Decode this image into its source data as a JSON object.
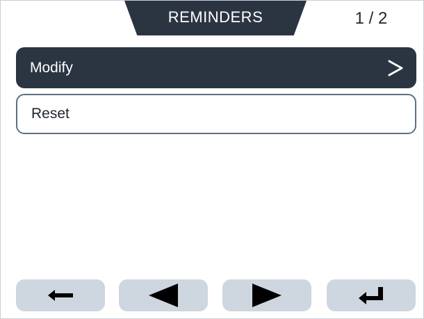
{
  "header": {
    "title": "REMINDERS",
    "page_indicator": "1 / 2"
  },
  "menu": {
    "items": [
      {
        "label": "Modify",
        "selected": true,
        "icon": "chevron-right-icon"
      },
      {
        "label": "Reset",
        "selected": false
      }
    ]
  },
  "buttons": [
    {
      "name": "back-button",
      "icon": "arrow-left-icon"
    },
    {
      "name": "previous-button",
      "icon": "triangle-left-icon"
    },
    {
      "name": "next-button",
      "icon": "triangle-right-icon"
    },
    {
      "name": "enter-button",
      "icon": "return-arrow-icon"
    }
  ],
  "colors": {
    "primary_dark": "#2b3542",
    "button_bg": "#ced7df",
    "border": "#5f6f80",
    "text_dark": "#1f252d",
    "text_light": "#ffffff"
  }
}
